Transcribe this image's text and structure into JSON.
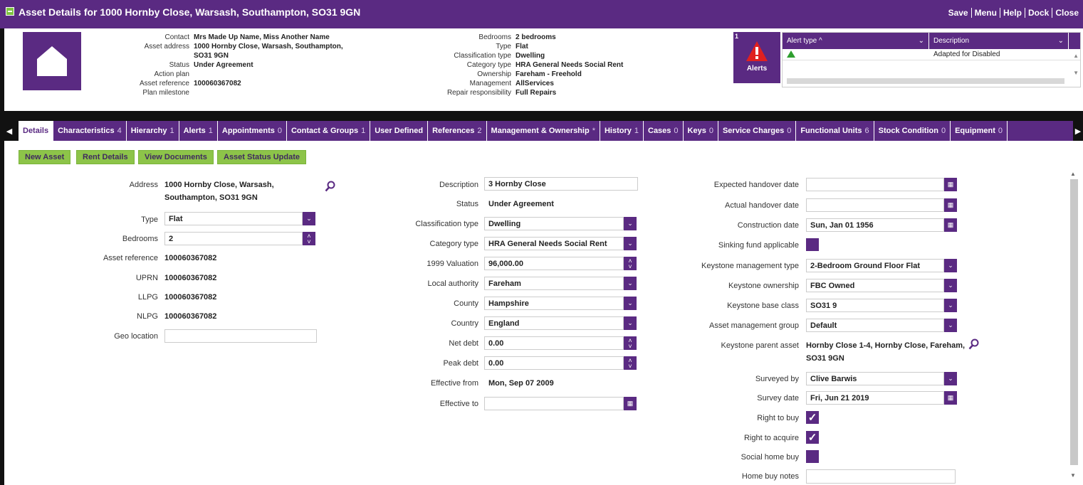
{
  "window": {
    "title": "Asset Details for 1000 Hornby Close, Warsash, Southampton, SO31 9GN",
    "actions": [
      "Save",
      "Menu",
      "Help",
      "Dock",
      "Close"
    ]
  },
  "header": {
    "left": [
      {
        "k": "Contact",
        "v": "Mrs Made Up Name, Miss Another Name"
      },
      {
        "k": "Asset address",
        "v": "1000 Hornby Close, Warsash, Southampton,"
      },
      {
        "k": "",
        "v": "SO31 9GN"
      },
      {
        "k": "Status",
        "v": "Under Agreement"
      },
      {
        "k": "Action plan",
        "v": ""
      },
      {
        "k": "Asset reference",
        "v": "100060367082"
      },
      {
        "k": "Plan milestone",
        "v": ""
      }
    ],
    "middle": [
      {
        "k": "Bedrooms",
        "v": "2 bedrooms"
      },
      {
        "k": "Type",
        "v": "Flat"
      },
      {
        "k": "Classification type",
        "v": "Dwelling"
      },
      {
        "k": "Category type",
        "v": "HRA General Needs Social Rent"
      },
      {
        "k": "Ownership",
        "v": "Fareham - Freehold"
      },
      {
        "k": "Management",
        "v": "AllServices"
      },
      {
        "k": "Repair responsibility",
        "v": "Full Repairs"
      }
    ],
    "alerts": {
      "count": "1",
      "label": "Alerts",
      "col_type": "Alert type",
      "col_desc": "Description",
      "row_desc": "Adapted for Disabled"
    }
  },
  "tabs": [
    {
      "label": "Details",
      "count": ""
    },
    {
      "label": "Characteristics",
      "count": "4"
    },
    {
      "label": "Hierarchy",
      "count": "1"
    },
    {
      "label": "Alerts",
      "count": "1"
    },
    {
      "label": "Appointments",
      "count": "0"
    },
    {
      "label": "Contact & Groups",
      "count": "1"
    },
    {
      "label": "User Defined",
      "count": ""
    },
    {
      "label": "References",
      "count": "2"
    },
    {
      "label": "Management & Ownership",
      "count": "*"
    },
    {
      "label": "History",
      "count": "1"
    },
    {
      "label": "Cases",
      "count": "0"
    },
    {
      "label": "Keys",
      "count": "0"
    },
    {
      "label": "Service Charges",
      "count": "0"
    },
    {
      "label": "Functional Units",
      "count": "6"
    },
    {
      "label": "Stock Condition",
      "count": "0"
    },
    {
      "label": "Equipment",
      "count": "0"
    }
  ],
  "buttons": {
    "new_asset": "New Asset",
    "rent_details": "Rent Details",
    "view_documents": "View Documents",
    "asset_status_update": "Asset Status Update"
  },
  "col1": {
    "address_label": "Address",
    "address_line1": "1000 Hornby Close, Warsash,",
    "address_line2": "Southampton, SO31 9GN",
    "type_label": "Type",
    "type_value": "Flat",
    "bedrooms_label": "Bedrooms",
    "bedrooms_value": "2",
    "asset_ref_label": "Asset reference",
    "asset_ref_value": "100060367082",
    "uprn_label": "UPRN",
    "uprn_value": "100060367082",
    "llpg_label": "LLPG",
    "llpg_value": "100060367082",
    "nlpg_label": "NLPG",
    "nlpg_value": "100060367082",
    "geo_label": "Geo location",
    "geo_value": ""
  },
  "col2": {
    "description_label": "Description",
    "description_value": "3 Hornby Close",
    "status_label": "Status",
    "status_value": "Under Agreement",
    "classification_label": "Classification type",
    "classification_value": "Dwelling",
    "category_label": "Category type",
    "category_value": "HRA General Needs Social Rent",
    "valuation_label": "1999 Valuation",
    "valuation_value": "96,000.00",
    "local_authority_label": "Local authority",
    "local_authority_value": "Fareham",
    "county_label": "County",
    "county_value": "Hampshire",
    "country_label": "Country",
    "country_value": "England",
    "net_debt_label": "Net debt",
    "net_debt_value": "0.00",
    "peak_debt_label": "Peak debt",
    "peak_debt_value": "0.00",
    "effective_from_label": "Effective from",
    "effective_from_value": "Mon, Sep 07 2009",
    "effective_to_label": "Effective to",
    "effective_to_value": ""
  },
  "col3": {
    "expected_handover_label": "Expected handover date",
    "expected_handover_value": "",
    "actual_handover_label": "Actual handover date",
    "actual_handover_value": "",
    "construction_label": "Construction date",
    "construction_value": "Sun, Jan 01 1956",
    "sinking_label": "Sinking fund applicable",
    "km_type_label": "Keystone management type",
    "km_type_value": "2-Bedroom Ground Floor Flat",
    "k_ownership_label": "Keystone ownership",
    "k_ownership_value": "FBC Owned",
    "k_base_label": "Keystone base class",
    "k_base_value": "SO31 9",
    "amg_label": "Asset management group",
    "amg_value": "Default",
    "k_parent_label": "Keystone parent asset",
    "k_parent_line1": "Hornby Close 1-4, Hornby Close, Fareham,",
    "k_parent_line2": "SO31 9GN",
    "surveyed_by_label": "Surveyed by",
    "surveyed_by_value": "Clive Barwis",
    "survey_date_label": "Survey date",
    "survey_date_value": "Fri, Jun 21 2019",
    "rtb_label": "Right to buy",
    "rta_label": "Right to acquire",
    "shb_label": "Social home buy",
    "hbn_label": "Home buy notes",
    "hbn_value": ""
  },
  "colors": {
    "brand": "#5a2a82",
    "button": "#8dc449",
    "alert_red": "#e02020",
    "alert_green": "#2e9e2e"
  }
}
